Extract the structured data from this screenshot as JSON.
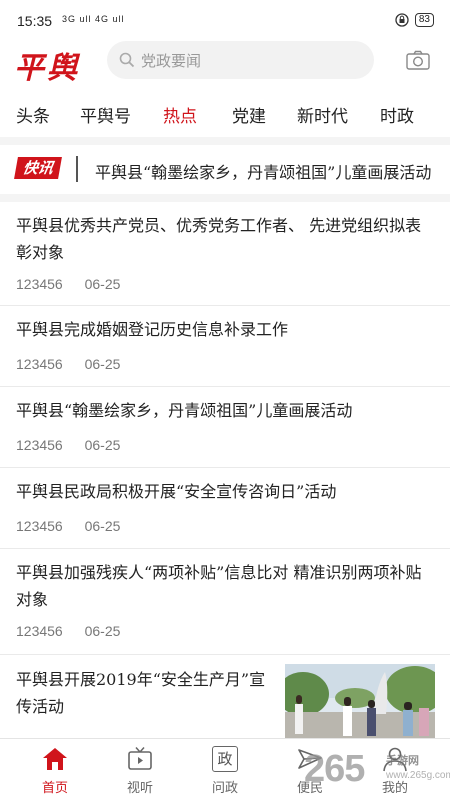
{
  "status_bar": {
    "time": "15:35",
    "signal": "3G ull 4G ull",
    "battery": "83"
  },
  "header": {
    "logo": "平舆",
    "search_placeholder": "党政要闻"
  },
  "tabs": [
    "头条",
    "平舆号",
    "热点",
    "党建",
    "新时代",
    "时政"
  ],
  "active_tab": "热点",
  "flash": {
    "badge": "快讯",
    "text": "平舆县“翰墨绘家乡，丹青颂祖国”儿童画展活动"
  },
  "news": [
    {
      "title": "平舆县优秀共产党员、优秀党务工作者、 先进党组织拟表彰对象",
      "views": "123456",
      "date": "06-25"
    },
    {
      "title": "平舆县完成婚姻登记历史信息补录工作",
      "views": "123456",
      "date": "06-25"
    },
    {
      "title": "平舆县“翰墨绘家乡，丹青颂祖国”儿童画展活动",
      "views": "123456",
      "date": "06-25"
    },
    {
      "title": "平舆县民政局积极开展“安全宣传咨询日”活动",
      "views": "123456",
      "date": "06-25"
    },
    {
      "title": "平舆县加强残疾人“两项补贴”信息比对 精准识别两项补贴对象",
      "views": "123456",
      "date": "06-25"
    },
    {
      "title": "平舆县开展2019年“安全生产月”宣传活动"
    }
  ],
  "bottom_nav": [
    "首页",
    "视听",
    "问政",
    "便民",
    "我的"
  ],
  "bottom_nav_active": "首页",
  "nav_icon_text": {
    "wenzheng": "政"
  },
  "watermark": {
    "brand": "265",
    "tag": "手游网",
    "url": "www.265g.com"
  },
  "colors": {
    "accent": "#d0141b",
    "text": "#222222",
    "meta": "#777777"
  }
}
